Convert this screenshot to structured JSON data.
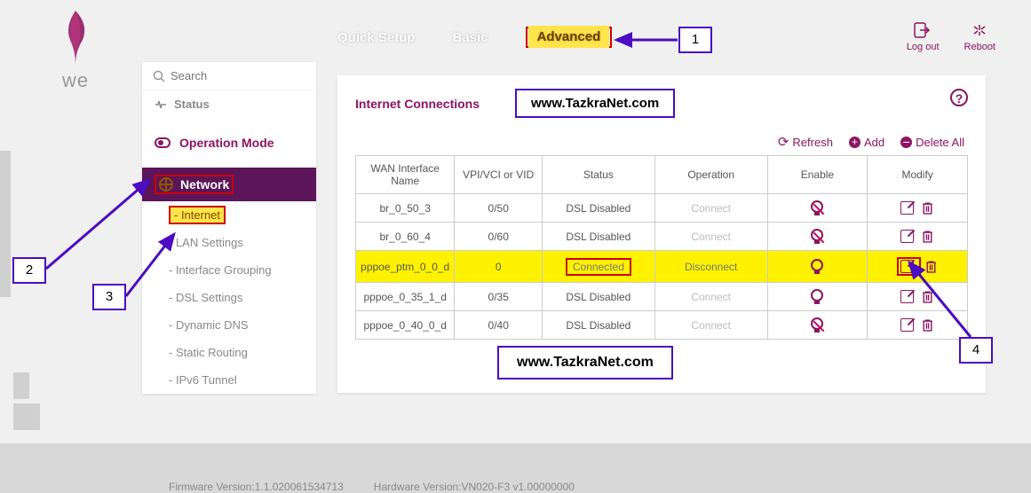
{
  "brand": {
    "name": "we"
  },
  "topnav": {
    "quick_setup": "Quick Setup",
    "basic": "Basic",
    "advanced": "Advanced"
  },
  "topright": {
    "logout": "Log out",
    "reboot": "Reboot"
  },
  "search": {
    "placeholder": "Search"
  },
  "sidebar": {
    "status": "Status",
    "opmode": "Operation Mode",
    "network": "Network",
    "items": [
      {
        "label": "- Internet"
      },
      {
        "label": "- LAN Settings"
      },
      {
        "label": "- Interface Grouping"
      },
      {
        "label": "- DSL Settings"
      },
      {
        "label": "- Dynamic DNS"
      },
      {
        "label": "- Static Routing"
      },
      {
        "label": "- IPv6 Tunnel"
      }
    ]
  },
  "panel": {
    "title": "Internet Connections",
    "watermark": "www.TazkraNet.com",
    "actions": {
      "refresh": "Refresh",
      "add": "Add",
      "delete_all": "Delete All"
    },
    "columns": {
      "wan": "WAN Interface Name",
      "vpi": "VPI/VCI or VID",
      "status": "Status",
      "operation": "Operation",
      "enable": "Enable",
      "modify": "Modify"
    },
    "rows": [
      {
        "name": "br_0_50_3",
        "vpi": "0/50",
        "status": "DSL Disabled",
        "operation": "Connect",
        "op_enabled": false,
        "bulb_on": false,
        "hl": false
      },
      {
        "name": "br_0_60_4",
        "vpi": "0/60",
        "status": "DSL Disabled",
        "operation": "Connect",
        "op_enabled": false,
        "bulb_on": false,
        "hl": false
      },
      {
        "name": "pppoe_ptm_0_0_d",
        "vpi": "0",
        "status": "Connected",
        "operation": "Disconnect",
        "op_enabled": true,
        "bulb_on": true,
        "hl": true
      },
      {
        "name": "pppoe_0_35_1_d",
        "vpi": "0/35",
        "status": "DSL Disabled",
        "operation": "Connect",
        "op_enabled": false,
        "bulb_on": true,
        "hl": false
      },
      {
        "name": "pppoe_0_40_0_d",
        "vpi": "0/40",
        "status": "DSL Disabled",
        "operation": "Connect",
        "op_enabled": false,
        "bulb_on": false,
        "hl": false
      }
    ]
  },
  "callouts": {
    "c1": "1",
    "c2": "2",
    "c3": "3",
    "c4": "4"
  },
  "footer": {
    "firmware": "Firmware Version:1.1.020061534713",
    "hardware": "Hardware Version:VN020-F3 v1.00000000"
  }
}
